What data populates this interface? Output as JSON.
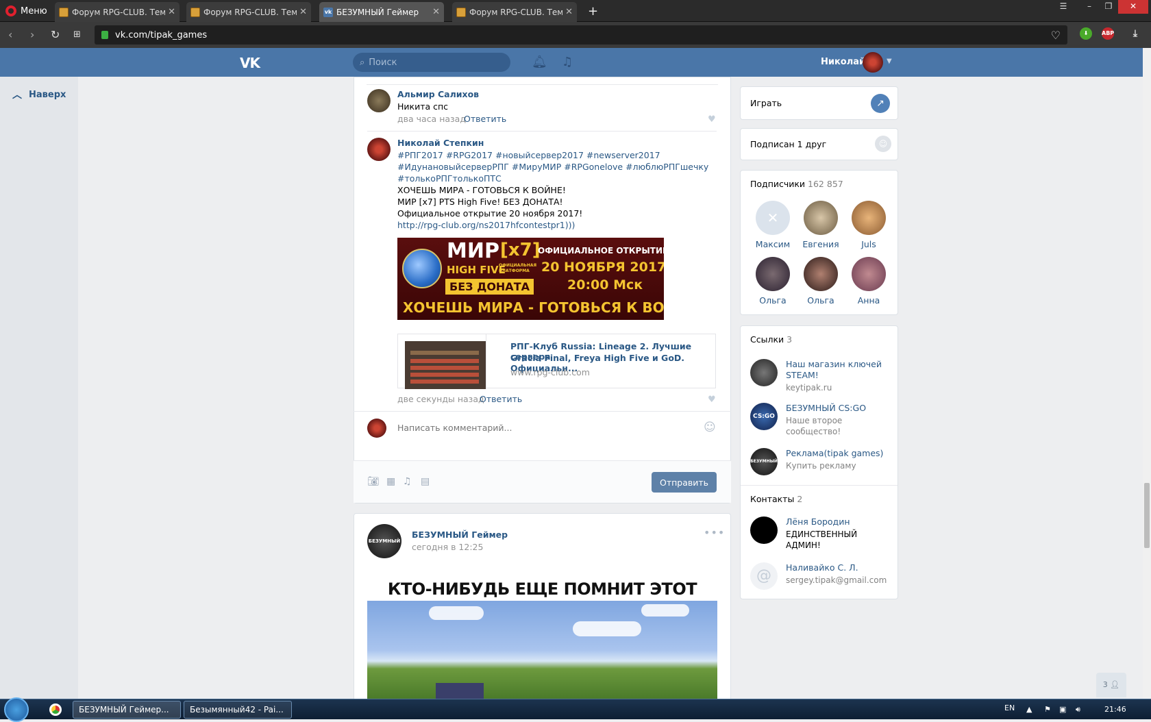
{
  "browser": {
    "menu_label": "Меню",
    "tabs": [
      {
        "title": "Форум RPG-CLUB. Тема: I"
      },
      {
        "title": "Форум RPG-CLUB. Тема: I"
      },
      {
        "title": "БЕЗУМНЫЙ Геймер"
      },
      {
        "title": "Форум RPG-CLUB. Тема: I"
      }
    ],
    "url": "vk.com/tipak_games"
  },
  "header": {
    "search_placeholder": "Поиск",
    "user_name": "Николай"
  },
  "leftnav": {
    "up_label": "Наверх"
  },
  "comments": [
    {
      "author": "Альмир Салихов",
      "text": "Никита спс",
      "time": "два часа назад",
      "reply": "Ответить"
    },
    {
      "author": "Николай Степкин",
      "hashtags1": "#РПГ2017 #RPG2017 #новыйсервер2017 #newserver2017",
      "hashtags2": "#ИдунановыйсерверРПГ #МируМИР #RPGonelove #люблюРПГшечку",
      "hashtags3": "#толькоРПГтолькоПТС",
      "line1": "ХОЧЕШЬ МИРА - ГОТОВЬСЯ К ВОЙНЕ!",
      "line2": "МИР [x7] PTS High Five! БЕЗ ДОНАТА!",
      "line3": "Официальное открытие 20 ноября 2017!",
      "url": "http://rpg-club.org/ns2017hfcontestpr1)))",
      "time": "две секунды назад",
      "reply": "Ответить"
    }
  ],
  "banner": {
    "mir": "МИР",
    "x7": "[x7]",
    "high_five": "HIGH FIVE",
    "platform": "ОФИЦИАЛЬНАЯ ПЛАТФОРМА",
    "opening": "ОФИЦИАЛЬНОЕ ОТКРЫТИЕ",
    "date": "20 НОЯБРЯ 2017",
    "time": "20:00 Мск",
    "no_donate": "БЕЗ ДОНАТА",
    "slogan": "ХОЧЕШЬ МИРА - ГОТОВЬСЯ К ВОЙНЕ"
  },
  "link_preview": {
    "title1": "РПГ-Клуб Russia: Lineage 2. Лучшие сервера",
    "title2": "Gracia Final, Freya High Five и GoD. Официальн...",
    "domain": "www.rpg-club.com"
  },
  "comment_box": {
    "placeholder": "Написать комментарий...",
    "send_label": "Отправить"
  },
  "post": {
    "author": "БЕЗУМНЫЙ Геймер",
    "time": "сегодня в 12:25",
    "avatar_text": "БЕЗУМНЫЙ",
    "image_caption": "КТО-НИБУДЬ ЕЩЕ ПОМНИТ ЭТОТ ШЕДЕВР?"
  },
  "rightcol": {
    "play_label": "Играть",
    "friend_label": "Подписан 1 друг",
    "subscribers_title": "Подписчики",
    "subscribers_count": "162 857",
    "subscribers": [
      {
        "name": "Максим"
      },
      {
        "name": "Евгения"
      },
      {
        "name": "Juls"
      },
      {
        "name": "Ольга"
      },
      {
        "name": "Ольга"
      },
      {
        "name": "Анна"
      }
    ],
    "links_title": "Ссылки",
    "links_count": "3",
    "links": [
      {
        "title": "Наш магазин ключей STEAM!",
        "sub": "keytipak.ru"
      },
      {
        "title": "БЕЗУМНЫЙ CS:GO",
        "sub": "Наше второе сообщество!"
      },
      {
        "title": "Реклама(tipak games)",
        "sub": "Купить рекламу"
      }
    ],
    "links_avatar_text": [
      "",
      "CS:GO",
      "БЕЗУМНЫЙ"
    ],
    "contacts_title": "Контакты",
    "contacts_count": "2",
    "contacts": [
      {
        "name": "Лёня Бородин",
        "role": "ЕДИНСТВЕННЫЙ АДМИН!"
      },
      {
        "name": "Наливайко С. Л.",
        "role": "sergey.tipak@gmail.com"
      }
    ]
  },
  "chat_badge": "3",
  "taskbar": {
    "items": [
      {
        "label": "БЕЗУМНЫЙ Геймер..."
      },
      {
        "label": "Безымянный42 - Pai..."
      }
    ],
    "lang": "EN",
    "clock": "21:46"
  }
}
